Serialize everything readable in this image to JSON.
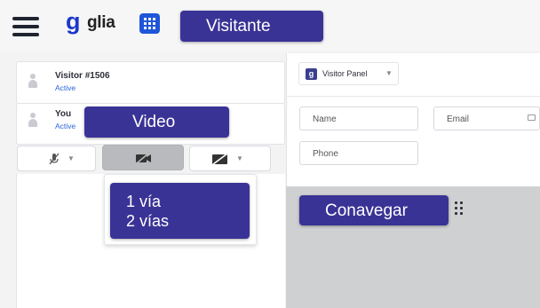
{
  "header": {
    "logo_mark": "g",
    "logo_text": "glia",
    "callout": "Visitante"
  },
  "visitor": {
    "name": "Visitor #1506",
    "status": "Active"
  },
  "self": {
    "name": "You",
    "status": "Active"
  },
  "video_callout": "Video",
  "video_options": [
    "1 vía",
    "2 vías"
  ],
  "visitor_panel": {
    "tab_label": "Visitor Panel",
    "tab_icon_glyph": "g",
    "fields": {
      "name_placeholder": "Name",
      "email_placeholder": "Email",
      "phone_placeholder": "Phone"
    }
  },
  "cobrowse_callout": "Conavegar",
  "icons": [
    "menu-icon",
    "apps-grid-icon",
    "mic-off-icon",
    "video-off-icon",
    "screen-share-off-icon",
    "drag-handle-icon",
    "mail-icon",
    "person-icon"
  ],
  "colors": {
    "brand_blue": "#1d38c9",
    "callout_purple": "#3a3396",
    "active_blue": "#2a62d9",
    "cobrowse_gray": "#cfd0d2"
  }
}
